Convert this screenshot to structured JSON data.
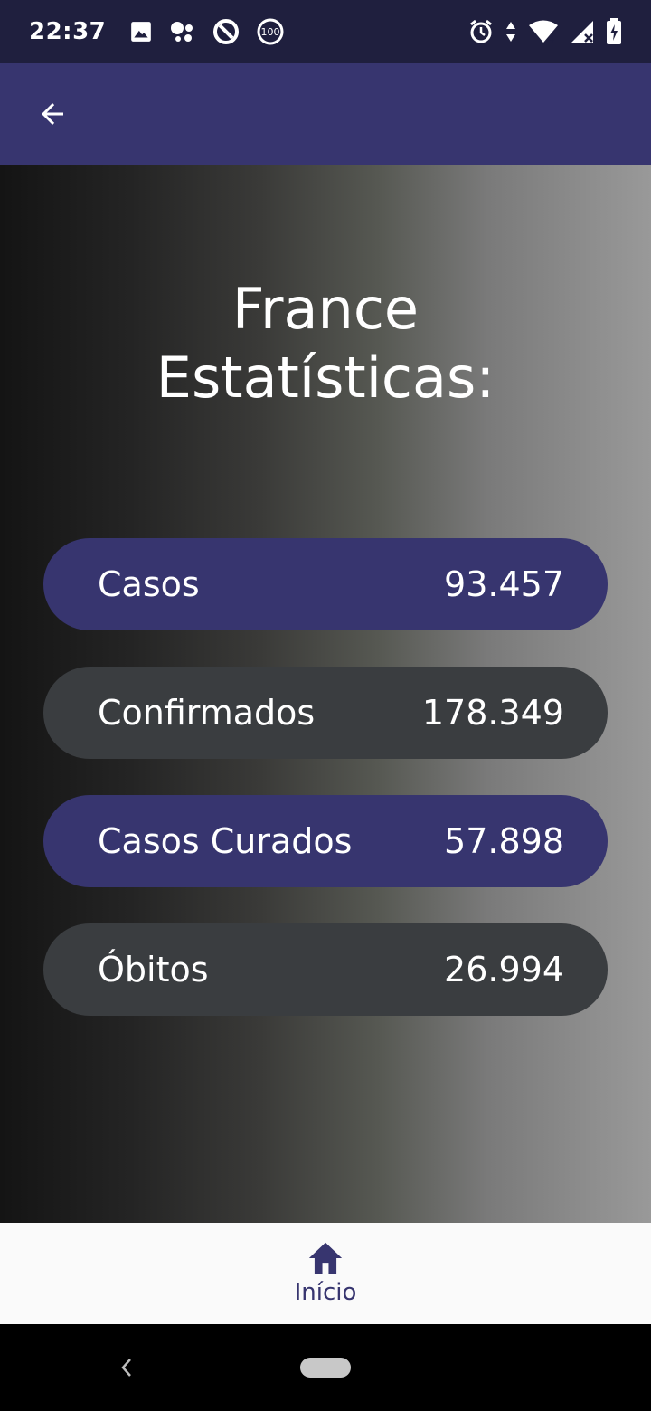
{
  "status_bar": {
    "time": "22:37",
    "left_icons": [
      "image-icon",
      "assistant-icon",
      "data-saver-icon",
      "battery-100-icon"
    ],
    "right_icons": [
      "alarm-icon",
      "data-arrows-icon",
      "wifi-icon",
      "cell-signal-icon",
      "battery-charging-icon"
    ],
    "wifi_badge": "4",
    "percent_badge": "100"
  },
  "app_bar": {
    "background": "#37356f"
  },
  "title": {
    "line1": "France",
    "line2": "Estatísticas:"
  },
  "stats": [
    {
      "label": "Casos",
      "value": "93.457",
      "color": "#37356f"
    },
    {
      "label": "Confirmados",
      "value": "178.349",
      "color": "#3a3d40"
    },
    {
      "label": "Casos Curados",
      "value": "57.898",
      "color": "#37356f"
    },
    {
      "label": "Óbitos",
      "value": "26.994",
      "color": "#3a3d40"
    }
  ],
  "bottom_nav": {
    "home_label": "Início",
    "icon": "home-icon"
  }
}
